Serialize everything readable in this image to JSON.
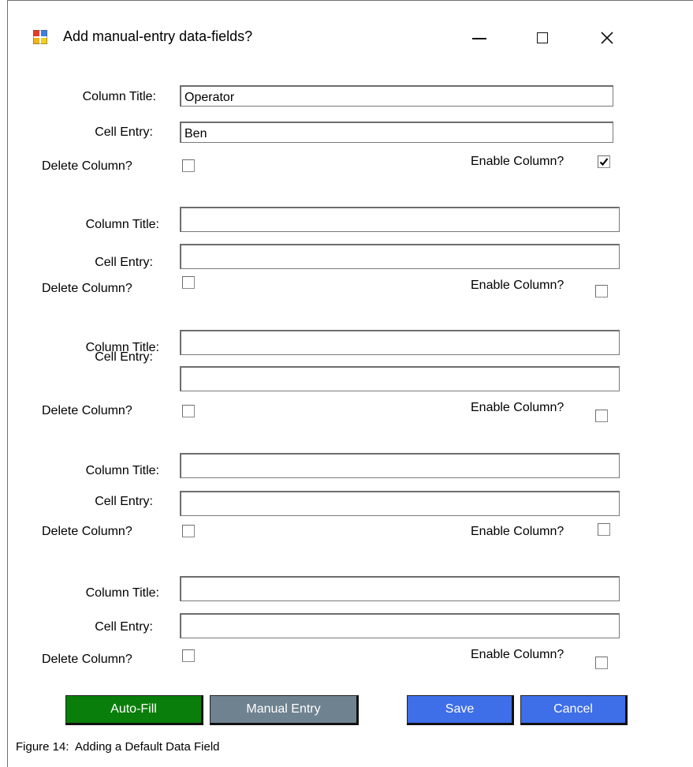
{
  "window": {
    "title": "Add manual-entry data-fields?",
    "controls": [
      "minimize-icon",
      "maximize-icon",
      "close-icon"
    ]
  },
  "labels": {
    "column_title": "Column Title:",
    "cell_entry": "Cell Entry:",
    "delete_column": "Delete Column?",
    "enable_column": "Enable Column?"
  },
  "rows": [
    {
      "column_title": "Operator",
      "cell_entry": "Ben",
      "delete_checked": false,
      "enable_checked": true
    },
    {
      "column_title": "",
      "cell_entry": "",
      "delete_checked": false,
      "enable_checked": false
    },
    {
      "column_title": "",
      "cell_entry": "",
      "delete_checked": false,
      "enable_checked": false
    },
    {
      "column_title": "",
      "cell_entry": "",
      "delete_checked": false,
      "enable_checked": false
    },
    {
      "column_title": "",
      "cell_entry": "",
      "delete_checked": false,
      "enable_checked": false
    }
  ],
  "buttons": {
    "auto_fill": "Auto-Fill",
    "manual_entry": "Manual Entry",
    "save": "Save",
    "cancel": "Cancel"
  },
  "colors": {
    "auto_fill": "#0a7e0a",
    "manual_entry": "#6f8290",
    "save": "#3e6ee8",
    "cancel": "#3e6ee8"
  },
  "caption": {
    "label": "Figure 14:",
    "text": "  Adding a Default Data Field"
  }
}
